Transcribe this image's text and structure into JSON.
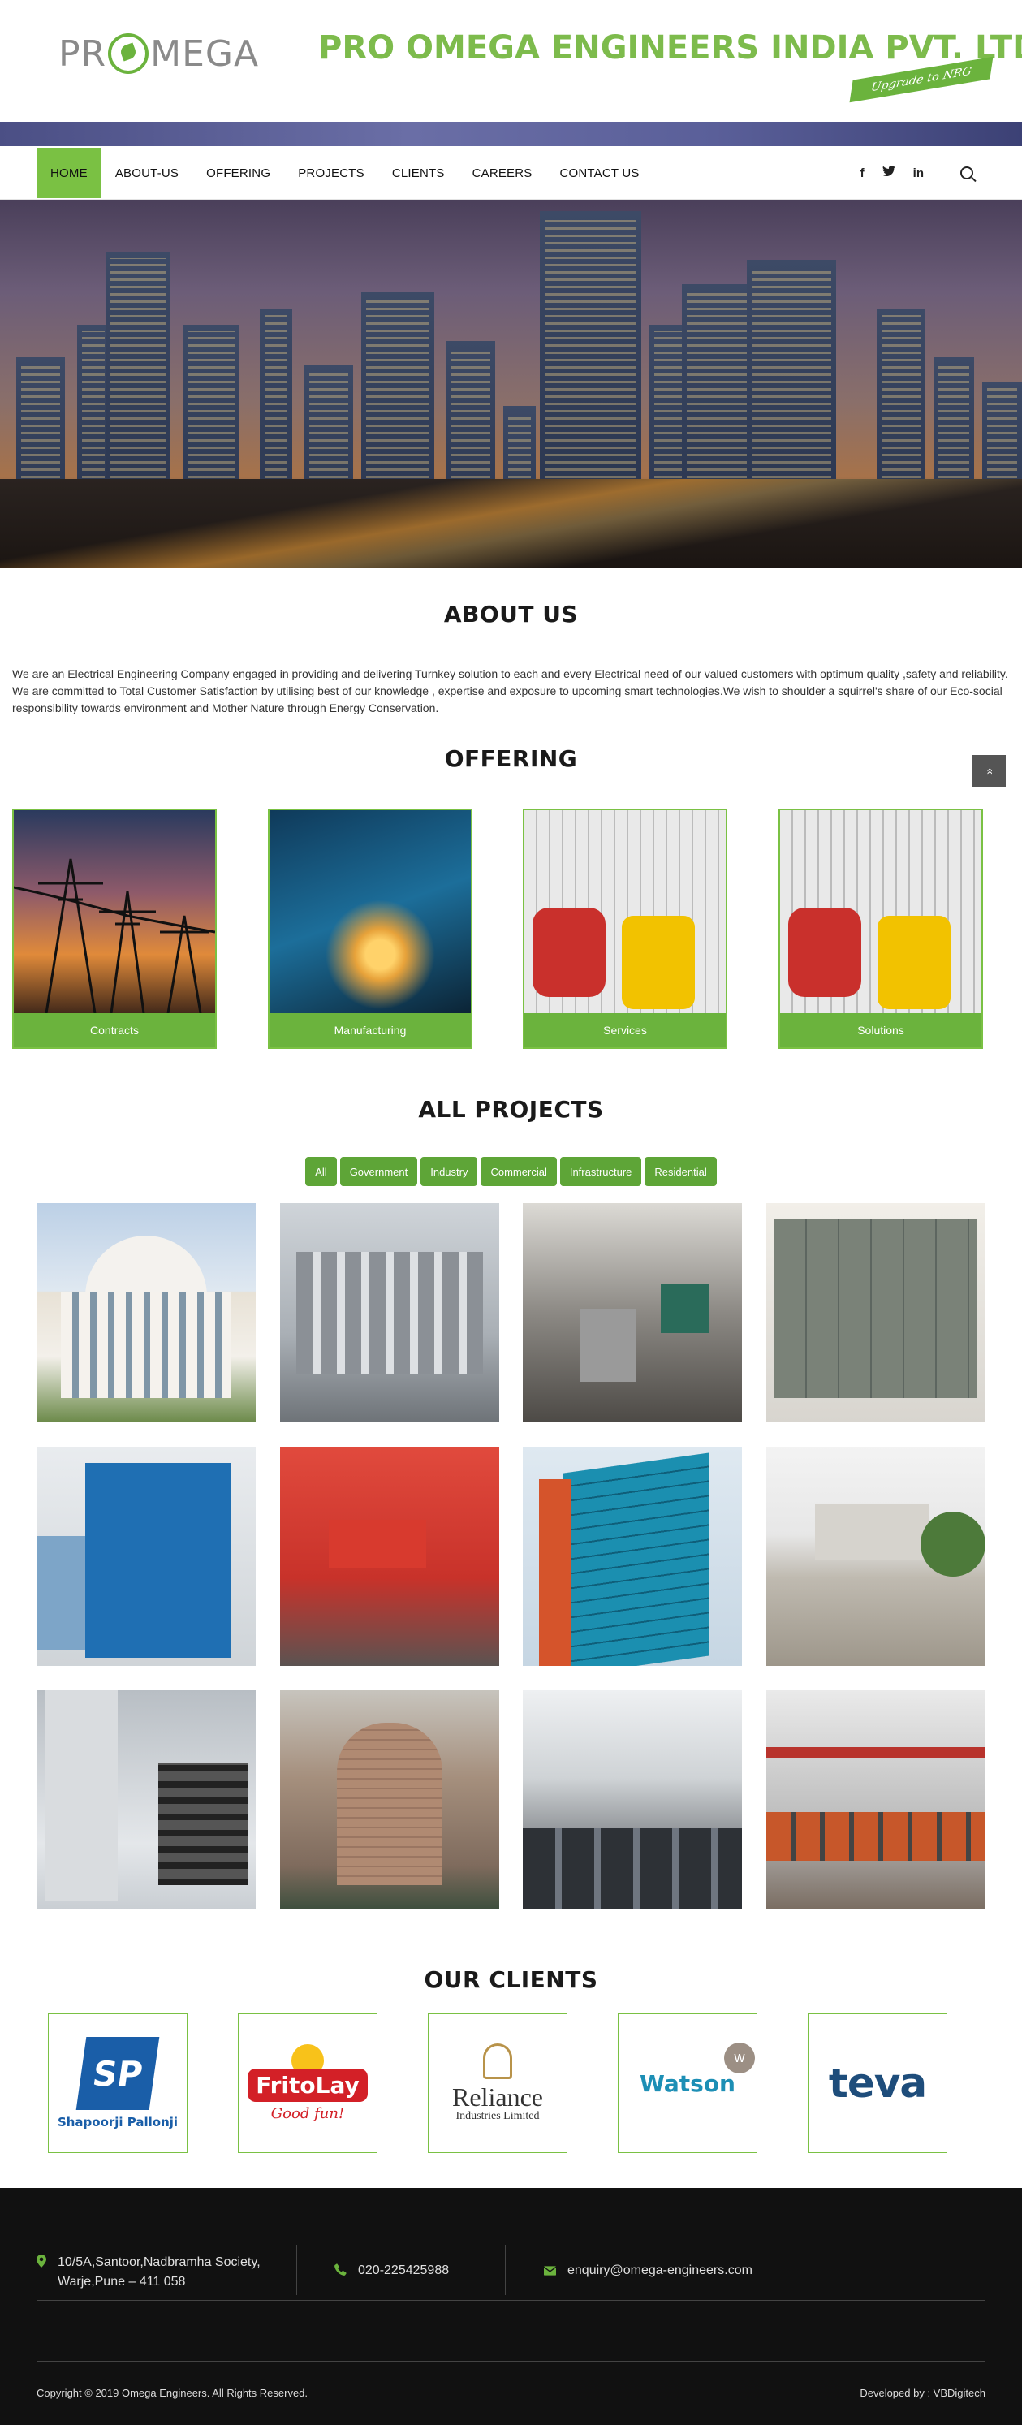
{
  "header": {
    "logo_text": "PR MEGA",
    "company_name": "PRO OMEGA ENGINEERS INDIA PVT. LTD.",
    "tagline": "Upgrade to NRG",
    "brand_color": "#7ac143"
  },
  "nav": {
    "items": [
      {
        "label": "HOME"
      },
      {
        "label": "ABOUT-US"
      },
      {
        "label": "OFFERING"
      },
      {
        "label": "PROJECTS"
      },
      {
        "label": "CLIENTS"
      },
      {
        "label": "CAREERS"
      },
      {
        "label": "CONTACT US"
      }
    ],
    "active": "HOME",
    "social": {
      "facebook": "f",
      "twitter": "t",
      "linkedin": "in"
    },
    "icons": [
      "facebook-icon",
      "twitter-icon",
      "linkedin-icon",
      "search-icon"
    ]
  },
  "about": {
    "title": "ABOUT US",
    "text": "We are an Electrical Engineering Company engaged in providing and delivering Turnkey solution to each and every Electrical need of our valued customers with optimum quality ,safety and reliability. We are committed to Total Customer Satisfaction by utilising best of our knowledge , expertise and exposure to upcoming smart technologies.We wish to shoulder a squirrel's share of our Eco-social responsibility towards environment and Mother Nature through Energy Conservation."
  },
  "scroll_top": {
    "icon": "chevrons-up-icon",
    "glyph": "»"
  },
  "offering": {
    "title": "OFFERING",
    "items": [
      {
        "label": "Contracts"
      },
      {
        "label": "Manufacturing"
      },
      {
        "label": "Services"
      },
      {
        "label": "Solutions"
      }
    ]
  },
  "projects": {
    "title": "ALL PROJECTS",
    "filters": [
      "All",
      "Government",
      "Industry",
      "Commercial",
      "Infrastructure",
      "Residential"
    ]
  },
  "clients": {
    "title": "OUR CLIENTS",
    "logos": [
      {
        "name": "Shapoorji Pallonji",
        "mark": "SP"
      },
      {
        "name": "FritoLay",
        "sub": "Good fun!"
      },
      {
        "name": "Reliance",
        "sub": "Industries Limited"
      },
      {
        "name": "Watson",
        "mark": "w"
      },
      {
        "name": "teva"
      }
    ]
  },
  "footer": {
    "address": "10/5A,Santoor,Nadbramha Society, Warje,Pune – 411 058",
    "phone": "020-225425988",
    "email": "enquiry@omega-engineers.com",
    "copyright": "Copyright © 2019 Omega Engineers. All Rights Reserved.",
    "developer": "Developed by : VBDigitech"
  }
}
